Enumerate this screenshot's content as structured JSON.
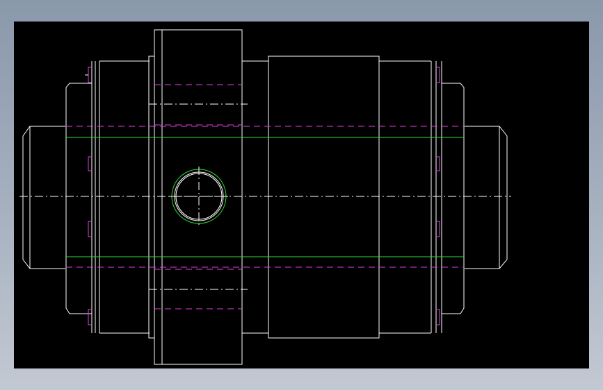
{
  "drawing": {
    "background": "#000000",
    "line_colors": {
      "outline": "#ffffff",
      "bore": "#33d933",
      "hidden": "#e040e0",
      "centerline": "#ffffff"
    }
  }
}
